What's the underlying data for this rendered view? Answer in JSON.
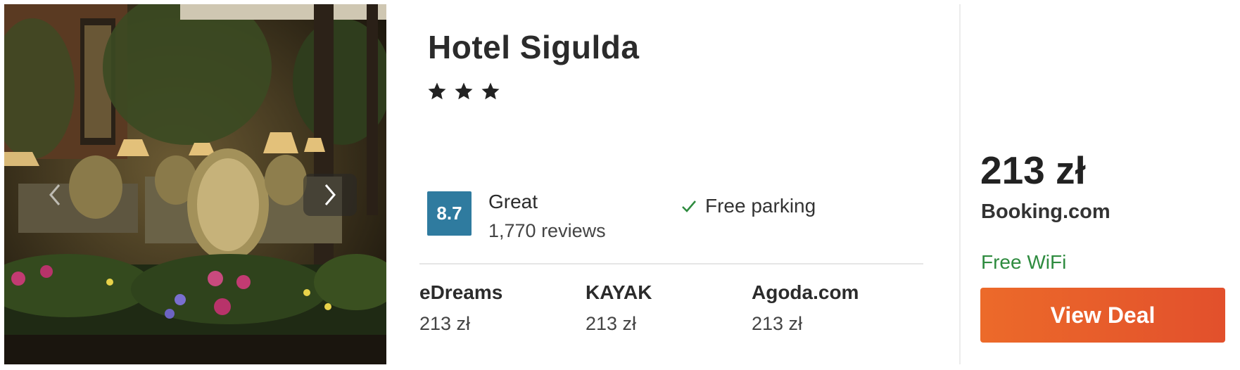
{
  "hotel": {
    "name": "Hotel Sigulda",
    "star_count": 3,
    "star_glyph": "★"
  },
  "rating": {
    "score": "8.7",
    "label": "Great",
    "reviews": "1,770 reviews",
    "badge_color": "#2f7b9f"
  },
  "amenities": {
    "middle": "Free parking",
    "right": "Free WiFi",
    "check_icon": "checkmark-icon",
    "right_color": "#2e8b3f"
  },
  "providers": [
    {
      "name": "eDreams",
      "price": "213 zł"
    },
    {
      "name": "KAYAK",
      "price": "213 zł"
    },
    {
      "name": "Agoda.com",
      "price": "213 zł"
    }
  ],
  "deal": {
    "price": "213 zł",
    "provider": "Booking.com",
    "button_label": "View Deal",
    "button_color": "#e65a2b"
  },
  "gallery": {
    "prev_icon": "chevron-left-icon",
    "next_icon": "chevron-right-icon"
  }
}
